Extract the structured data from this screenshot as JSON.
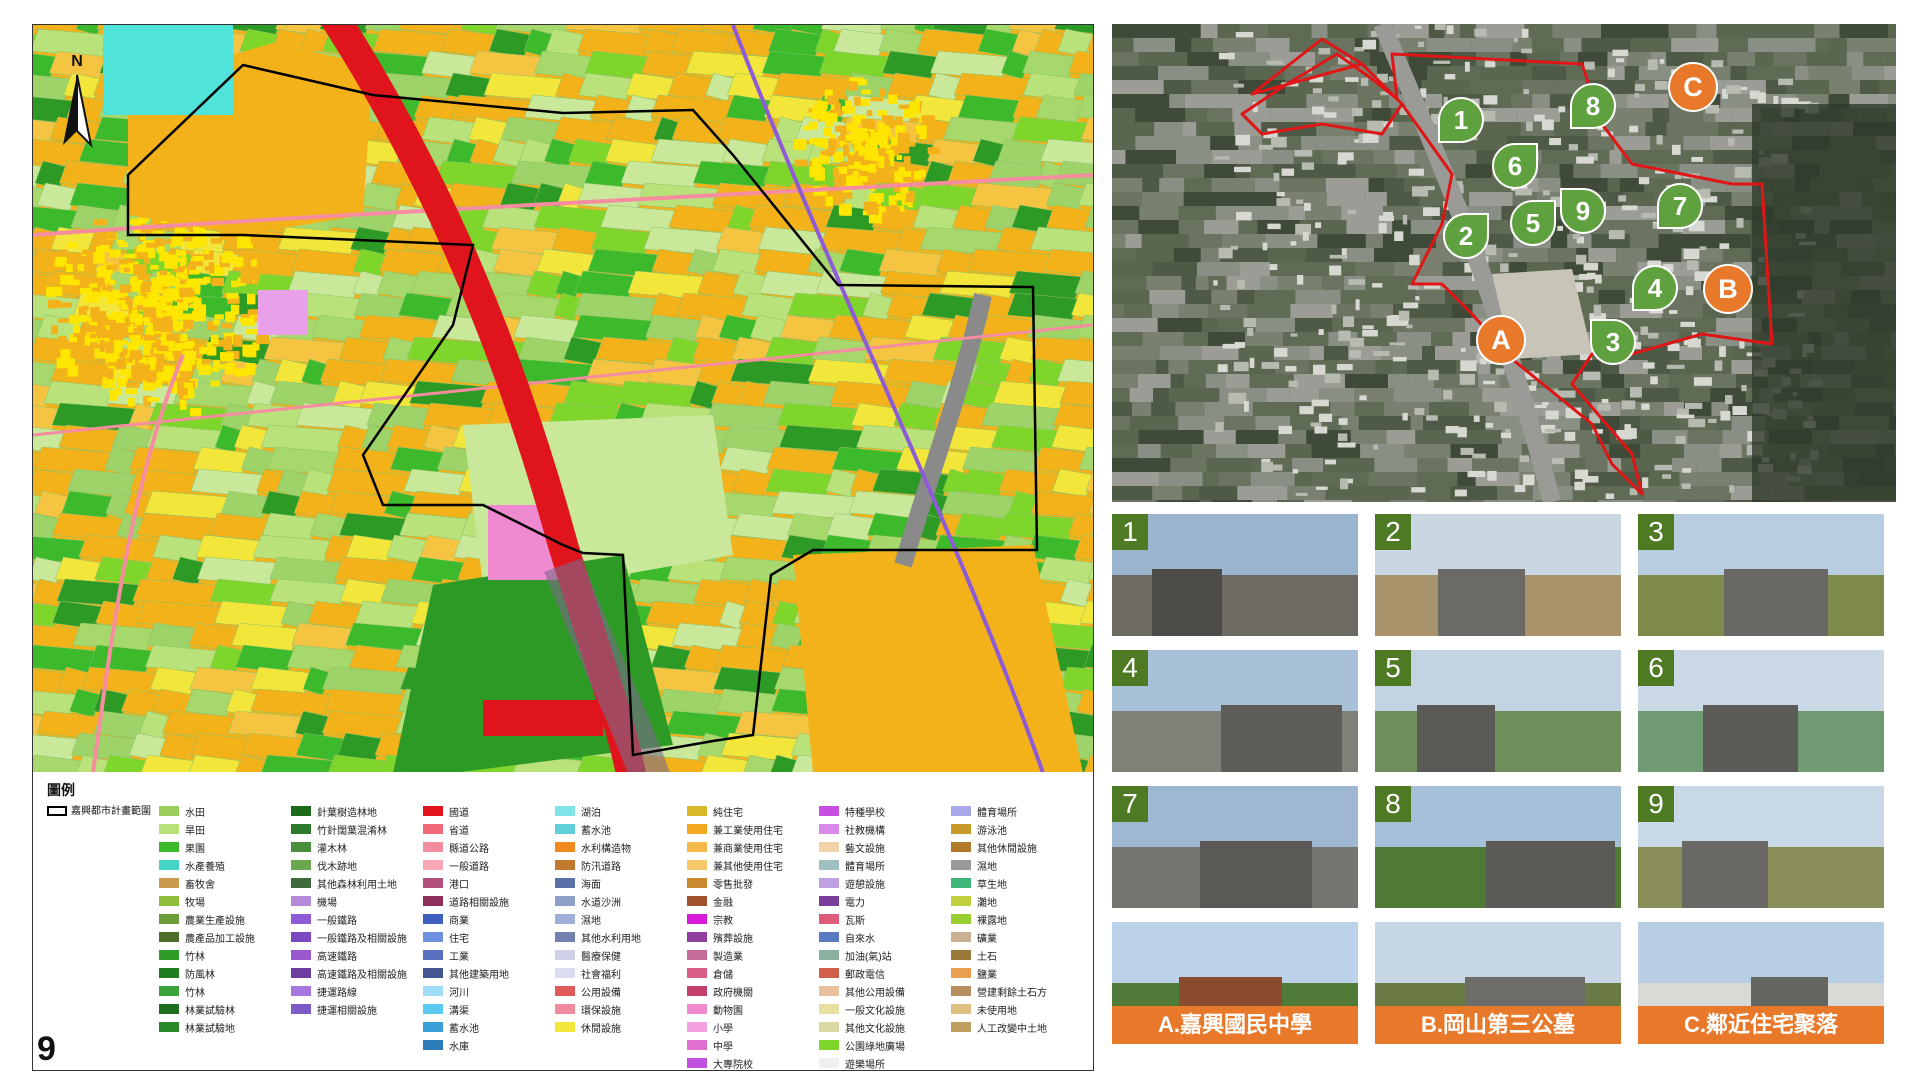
{
  "figure": {
    "number": "9"
  },
  "map": {
    "north_label": "N"
  },
  "legend": {
    "title": "圖例",
    "boundary_label": "嘉興都市計畫範圍",
    "columns": [
      [
        {
          "label": "水田",
          "color": "#9acd5b"
        },
        {
          "label": "旱田",
          "color": "#b9e27a"
        },
        {
          "label": "果園",
          "color": "#3cba2c"
        },
        {
          "label": "水產養殖",
          "color": "#46d4c6"
        },
        {
          "label": "畜牧舍",
          "color": "#c99a4b"
        },
        {
          "label": "牧場",
          "color": "#8fbf3a"
        },
        {
          "label": "農業生產設施",
          "color": "#6d9d3a"
        },
        {
          "label": "農產品加工設施",
          "color": "#4e6e2a"
        },
        {
          "label": "竹林",
          "color": "#2f9c2a"
        },
        {
          "label": "防風林",
          "color": "#1f7d1f"
        },
        {
          "label": "竹林",
          "color": "#3aa33a"
        },
        {
          "label": "林業試驗林",
          "color": "#1e6e1e"
        },
        {
          "label": "林業試驗地",
          "color": "#2a8a2a"
        }
      ],
      [
        {
          "label": "針葉樹造林地",
          "color": "#1b6b1b"
        },
        {
          "label": "竹針闊葉混淆林",
          "color": "#2d7a2d"
        },
        {
          "label": "灌木林",
          "color": "#4a8f3a"
        },
        {
          "label": "伐木跡地",
          "color": "#6aa84f"
        },
        {
          "label": "其他森林利用土地",
          "color": "#3d6b3d"
        },
        {
          "label": "機場",
          "color": "#b38bd9"
        },
        {
          "label": "一般鐵路",
          "color": "#8e5bd6"
        },
        {
          "label": "一般鐵路及相關設施",
          "color": "#7a49c2"
        },
        {
          "label": "高速鐵路",
          "color": "#9b59d0"
        },
        {
          "label": "高速鐵路及相關設施",
          "color": "#6b3fa0"
        },
        {
          "label": "捷運路線",
          "color": "#a678e0"
        },
        {
          "label": "捷運相關設施",
          "color": "#7d5bc6"
        }
      ],
      [
        {
          "label": "國道",
          "color": "#e0141c"
        },
        {
          "label": "省道",
          "color": "#f06a7a"
        },
        {
          "label": "縣道公路",
          "color": "#f58ca0"
        },
        {
          "label": "一般道路",
          "color": "#f9a7b5"
        },
        {
          "label": "港口",
          "color": "#b04f7a"
        },
        {
          "label": "道路相關設施",
          "color": "#8c2f5a"
        },
        {
          "label": "商業",
          "color": "#3f5fbf"
        },
        {
          "label": "住宅",
          "color": "#6f8fe0"
        },
        {
          "label": "工業",
          "color": "#5a6fbf"
        },
        {
          "label": "其他建築用地",
          "color": "#44558f"
        },
        {
          "label": "河川",
          "color": "#9fdcf7"
        },
        {
          "label": "溝渠",
          "color": "#5ac8f0"
        },
        {
          "label": "蓄水池",
          "color": "#3aa0d8"
        },
        {
          "label": "水庫",
          "color": "#2b7cb8"
        }
      ],
      [
        {
          "label": "湖泊",
          "color": "#7fe3e8"
        },
        {
          "label": "蓄水池",
          "color": "#5fd0d8"
        },
        {
          "label": "水利構造物",
          "color": "#f08a1f"
        },
        {
          "label": "防汛道路",
          "color": "#bf7a2f"
        },
        {
          "label": "海面",
          "color": "#5b6fa8"
        },
        {
          "label": "水道沙洲",
          "color": "#8fa0c8"
        },
        {
          "label": "濕地",
          "color": "#9fb0d8"
        },
        {
          "label": "其他水利用地",
          "color": "#7380b0"
        },
        {
          "label": "醫療保健",
          "color": "#cfcfe8"
        },
        {
          "label": "社會福利",
          "color": "#dcdcf0"
        },
        {
          "label": "公用設備",
          "color": "#e05a5a"
        },
        {
          "label": "環保設施",
          "color": "#f08aa0"
        },
        {
          "label": "休閒設施",
          "color": "#f2e63a"
        }
      ],
      [
        {
          "label": "純住宅",
          "color": "#d9b82a"
        },
        {
          "label": "兼工業使用住宅",
          "color": "#f2a81f"
        },
        {
          "label": "兼商業使用住宅",
          "color": "#f5b84a"
        },
        {
          "label": "兼其他使用住宅",
          "color": "#f7c86a"
        },
        {
          "label": "零售批發",
          "color": "#c98a2f"
        },
        {
          "label": "金融",
          "color": "#a0522d"
        },
        {
          "label": "宗教",
          "color": "#d81bd8"
        },
        {
          "label": "殯葬設施",
          "color": "#8f3fa0"
        },
        {
          "label": "製造業",
          "color": "#c46b9a"
        },
        {
          "label": "倉儲",
          "color": "#d95f8a"
        },
        {
          "label": "政府機關",
          "color": "#c43f6a"
        },
        {
          "label": "動物園",
          "color": "#f08ad0"
        },
        {
          "label": "小學",
          "color": "#f5a0e0"
        },
        {
          "label": "中學",
          "color": "#e070d0"
        },
        {
          "label": "大專院校",
          "color": "#c050e0"
        }
      ],
      [
        {
          "label": "特種學校",
          "color": "#c64ee0"
        },
        {
          "label": "社教機構",
          "color": "#d98ae8"
        },
        {
          "label": "藝文設施",
          "color": "#f2d2a8"
        },
        {
          "label": "體育場所",
          "color": "#a0c0c0"
        },
        {
          "label": "遊憩設施",
          "color": "#c0a0e0"
        },
        {
          "label": "電力",
          "color": "#7a3f9a"
        },
        {
          "label": "瓦斯",
          "color": "#e05a7a"
        },
        {
          "label": "自來水",
          "color": "#5a7ac0"
        },
        {
          "label": "加油(氣)站",
          "color": "#8ab0a0"
        },
        {
          "label": "郵政電信",
          "color": "#d0604a"
        },
        {
          "label": "其他公用設備",
          "color": "#e8c0a0"
        },
        {
          "label": "一般文化設施",
          "color": "#e8e0a0"
        },
        {
          "label": "其他文化設施",
          "color": "#d8d8a0"
        },
        {
          "label": "公園綠地廣場",
          "color": "#7fd62a"
        },
        {
          "label": "遊樂場所",
          "color": "#f0f0f0"
        }
      ],
      [
        {
          "label": "體育場所",
          "color": "#a8a8e8"
        },
        {
          "label": "游泳池",
          "color": "#c89a2a"
        },
        {
          "label": "其他休閒設施",
          "color": "#b07a2a"
        },
        {
          "label": "濕地",
          "color": "#9a9a9a"
        },
        {
          "label": "草生地",
          "color": "#3fb57a"
        },
        {
          "label": "灘地",
          "color": "#c0d040"
        },
        {
          "label": "裸露地",
          "color": "#9acd30"
        },
        {
          "label": "礦業",
          "color": "#c8b090"
        },
        {
          "label": "土石",
          "color": "#9a7a3a"
        },
        {
          "label": "鹽業",
          "color": "#e8a050"
        },
        {
          "label": "營建剩餘土石方",
          "color": "#b89060"
        },
        {
          "label": "未使用地",
          "color": "#e0c080"
        },
        {
          "label": "人工改變中土地",
          "color": "#c0a060"
        }
      ]
    ]
  },
  "photos": [
    {
      "badge": "1",
      "caption": ""
    },
    {
      "badge": "2",
      "caption": ""
    },
    {
      "badge": "3",
      "caption": ""
    },
    {
      "badge": "4",
      "caption": ""
    },
    {
      "badge": "5",
      "caption": ""
    },
    {
      "badge": "6",
      "caption": ""
    },
    {
      "badge": "7",
      "caption": ""
    },
    {
      "badge": "8",
      "caption": ""
    },
    {
      "badge": "9",
      "caption": ""
    },
    {
      "badge": "",
      "caption": "A.嘉興國民中學"
    },
    {
      "badge": "",
      "caption": "B.岡山第三公墓"
    },
    {
      "badge": "",
      "caption": "C.鄰近住宅聚落"
    }
  ],
  "satellite": {
    "site_markers": [
      "1",
      "2",
      "3",
      "4",
      "5",
      "6",
      "7",
      "8",
      "9"
    ],
    "poi_markers": [
      "A",
      "B",
      "C"
    ]
  }
}
